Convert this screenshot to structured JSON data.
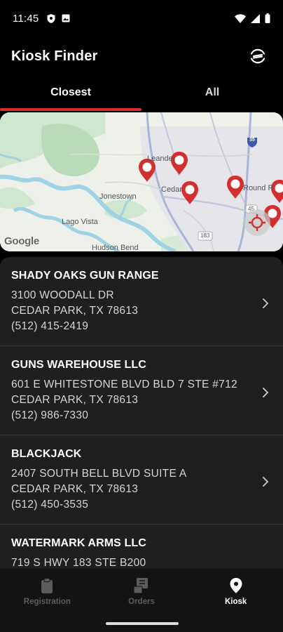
{
  "status_bar": {
    "time": "11:45"
  },
  "app": {
    "title": "Kiosk Finder"
  },
  "tabs": [
    {
      "label": "Closest",
      "active": true
    },
    {
      "label": "All",
      "active": false
    }
  ],
  "map": {
    "labels": {
      "leander": "Leander",
      "cedar": "Cedar",
      "round": "Round R",
      "jonestown": "Jonestown",
      "lago_vista": "Lago Vista",
      "hudson_bend": "Hudson Bend",
      "hwy_35": "35",
      "hwy_183": "183",
      "hwy_45": "45"
    },
    "attribution": "Google"
  },
  "kiosks": [
    {
      "name": "SHADY OAKS GUN RANGE",
      "address1": "3100 WOODALL DR",
      "city": "CEDAR PARK, TX 78613",
      "phone": "(512) 415-2419"
    },
    {
      "name": "GUNS WAREHOUSE LLC",
      "address1": "601 E WHITESTONE BLVD  BLD 7 STE #712",
      "city": "CEDAR PARK, TX 78613",
      "phone": "(512) 986-7330"
    },
    {
      "name": "BLACKJACK",
      "address1": "2407 SOUTH BELL BLVD SUITE A",
      "city": "CEDAR PARK, TX 78613",
      "phone": "(512) 450-3535"
    },
    {
      "name": "WATERMARK ARMS LLC",
      "address1": "719 S HWY 183 STE B200",
      "city": "",
      "phone": ""
    }
  ],
  "nav": [
    {
      "label": "Registration",
      "icon": "clipboard-icon",
      "active": false
    },
    {
      "label": "Orders",
      "icon": "orders-icon",
      "active": false
    },
    {
      "label": "Kiosk",
      "icon": "location-pin-icon",
      "active": true
    }
  ],
  "colors": {
    "accent": "#d32f2f",
    "background": "#000000",
    "list_background": "#1f1f1f"
  }
}
